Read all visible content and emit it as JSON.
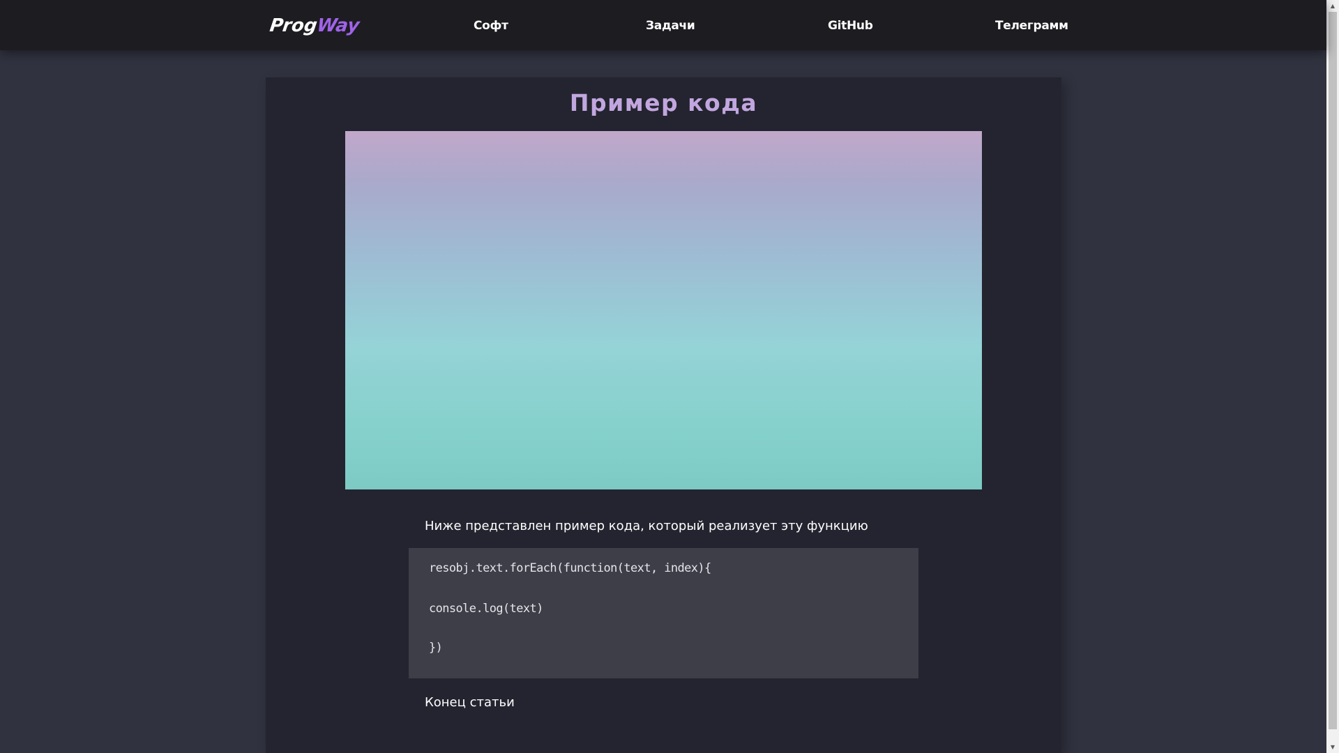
{
  "navbar": {
    "logo": {
      "part1": "Prog",
      "part2": "Way"
    },
    "links": [
      {
        "label": "Софт"
      },
      {
        "label": "Задачи"
      },
      {
        "label": "GitHub"
      },
      {
        "label": "Телеграмм"
      }
    ]
  },
  "article": {
    "title": "Пример кода",
    "intro": "Ниже представлен пример кода, который реализует эту функцию",
    "code_lines": [
      "resobj.text.forEach(function(text, index){",
      "console.log(text)",
      "})"
    ],
    "end": "Конец статьи"
  },
  "colors": {
    "accent_title": "#c2a6df",
    "logo_accent": "#9f63e8",
    "navbar_bg": "#1c1c21",
    "page_bg": "#30323f",
    "article_bg": "#23242f",
    "code_bg": "#3e3e48"
  },
  "icons": {
    "scroll_up": "▲",
    "scroll_down": "▼"
  }
}
